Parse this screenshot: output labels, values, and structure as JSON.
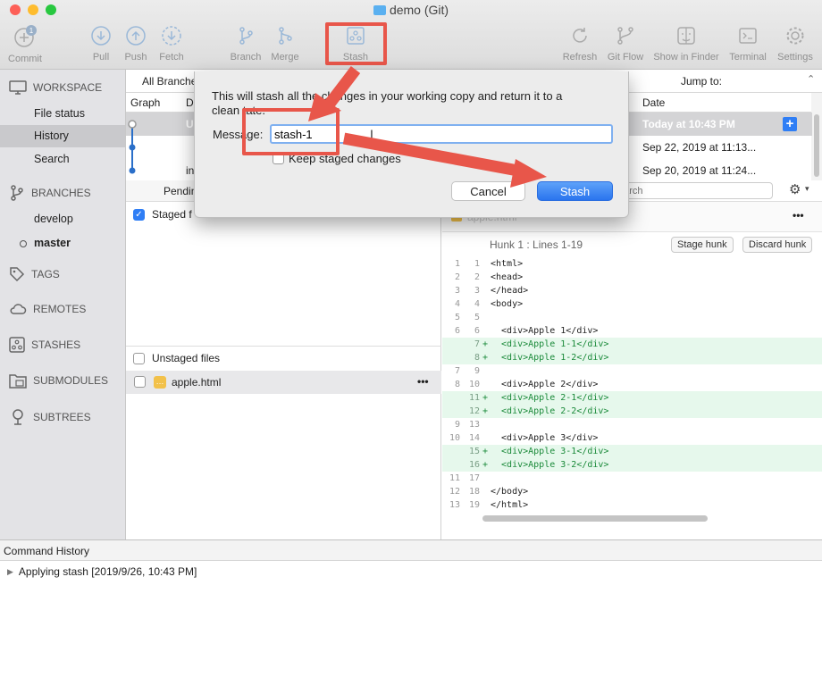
{
  "window": {
    "title": "demo (Git)"
  },
  "toolbar": {
    "commit": "Commit",
    "commit_badge": "1",
    "pull": "Pull",
    "push": "Push",
    "fetch": "Fetch",
    "branch": "Branch",
    "merge": "Merge",
    "stash": "Stash",
    "refresh": "Refresh",
    "gitflow": "Git Flow",
    "finder": "Show in Finder",
    "terminal": "Terminal",
    "settings": "Settings"
  },
  "sidebar": {
    "workspace": "WORKSPACE",
    "workspace_items": [
      "File status",
      "History",
      "Search"
    ],
    "branches": "BRANCHES",
    "branch_items": [
      "develop",
      "master"
    ],
    "tags": "TAGS",
    "remotes": "REMOTES",
    "stashes": "STASHES",
    "submodules": "SUBMODULES",
    "subtrees": "SUBTREES"
  },
  "history": {
    "filter": "All Branche",
    "jump_label": "Jump to:",
    "col_graph": "Graph",
    "col_desc": "D",
    "col_date": "Date",
    "rows": [
      {
        "desc": "U",
        "date": "Today at 10:43 PM"
      },
      {
        "desc": "",
        "date": "Sep 22, 2019 at 11:13..."
      },
      {
        "desc": "in",
        "date": "Sep 20, 2019 at 11:24..."
      }
    ]
  },
  "staging": {
    "pending_label": "Pendin",
    "staged_label": "Staged f",
    "unstaged_label": "Unstaged files",
    "file": "apple.html",
    "more": "•••"
  },
  "diff": {
    "search_placeholder": "earch",
    "file_header": "apple.html",
    "hunk_title": "Hunk 1 : Lines 1-19",
    "stage_hunk": "Stage hunk",
    "discard_hunk": "Discard hunk",
    "lines": [
      {
        "old": "1",
        "new": "1",
        "sign": "",
        "code": "<html>"
      },
      {
        "old": "2",
        "new": "2",
        "sign": "",
        "code": "<head>"
      },
      {
        "old": "3",
        "new": "3",
        "sign": "",
        "code": "</head>"
      },
      {
        "old": "4",
        "new": "4",
        "sign": "",
        "code": "<body>"
      },
      {
        "old": "5",
        "new": "5",
        "sign": "",
        "code": ""
      },
      {
        "old": "6",
        "new": "6",
        "sign": "",
        "code": "  <div>Apple 1</div>"
      },
      {
        "old": "",
        "new": "7",
        "sign": "+",
        "code": "  <div>Apple 1-1</div>"
      },
      {
        "old": "",
        "new": "8",
        "sign": "+",
        "code": "  <div>Apple 1-2</div>"
      },
      {
        "old": "7",
        "new": "9",
        "sign": "",
        "code": ""
      },
      {
        "old": "8",
        "new": "10",
        "sign": "",
        "code": "  <div>Apple 2</div>"
      },
      {
        "old": "",
        "new": "11",
        "sign": "+",
        "code": "  <div>Apple 2-1</div>"
      },
      {
        "old": "",
        "new": "12",
        "sign": "+",
        "code": "  <div>Apple 2-2</div>"
      },
      {
        "old": "9",
        "new": "13",
        "sign": "",
        "code": ""
      },
      {
        "old": "10",
        "new": "14",
        "sign": "",
        "code": "  <div>Apple 3</div>"
      },
      {
        "old": "",
        "new": "15",
        "sign": "+",
        "code": "  <div>Apple 3-1</div>"
      },
      {
        "old": "",
        "new": "16",
        "sign": "+",
        "code": "  <div>Apple 3-2</div>"
      },
      {
        "old": "11",
        "new": "17",
        "sign": "",
        "code": ""
      },
      {
        "old": "12",
        "new": "18",
        "sign": "",
        "code": "</body>"
      },
      {
        "old": "13",
        "new": "19",
        "sign": "",
        "code": "</html>"
      }
    ]
  },
  "command_history": {
    "title": "Command History",
    "entry": "Applying stash [2019/9/26, 10:43 PM]"
  },
  "dialog": {
    "message_text_a": "This will stash all the",
    "message_text_b": "changes in your working copy and return it to a",
    "message_text_c": "clean",
    "message_text_d": "tate.",
    "message_label": "Message:",
    "message_value": "stash-1",
    "keep_staged": "Keep staged changes",
    "cancel": "Cancel",
    "stash": "Stash"
  },
  "colors": {
    "accent": "#2f7ef5",
    "annotation": "#e8564a",
    "added": "#1b8a3a"
  }
}
